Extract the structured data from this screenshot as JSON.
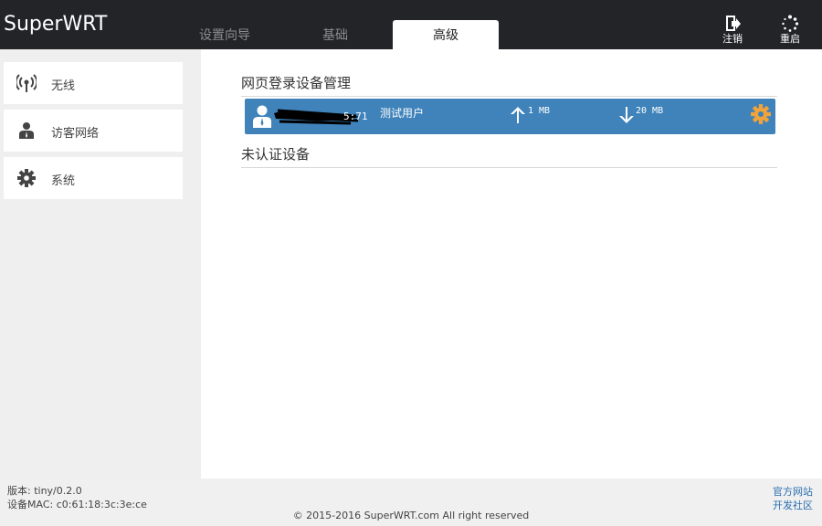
{
  "header": {
    "brand": "SuperWRT",
    "tabs": [
      {
        "label": "设置向导",
        "active": false
      },
      {
        "label": "基础",
        "active": false
      },
      {
        "label": "高级",
        "active": true
      }
    ],
    "logout_label": "注销",
    "reboot_label": "重启"
  },
  "sidebar": {
    "items": [
      {
        "label": "无线",
        "icon": "wifi-icon"
      },
      {
        "label": "访客网络",
        "icon": "user-icon"
      },
      {
        "label": "系统",
        "icon": "gear-icon"
      }
    ]
  },
  "main": {
    "section_title": "网页登录设备管理",
    "device": {
      "mac_suffix": "5:71",
      "name": "测试用户",
      "upload": "1 MB",
      "download": "20 MB"
    },
    "unauth_title": "未认证设备"
  },
  "footer": {
    "version": "版本: tiny/0.2.0",
    "mac": "设备MAC: c0:61:18:3c:3e:ce",
    "copyright": "© 2015-2016 SuperWRT.com All right reserved",
    "link_official": "官方网站",
    "link_dev": "开发社区"
  },
  "colors": {
    "topbar": "#222428",
    "accent_blue": "#3f83ba",
    "gear_orange": "#f0a33a",
    "link": "#2a6fb0"
  }
}
